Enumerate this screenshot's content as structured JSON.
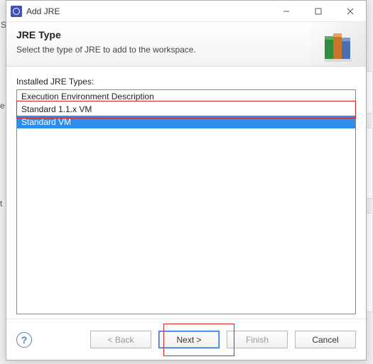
{
  "window": {
    "title": "Add JRE"
  },
  "header": {
    "title": "JRE Type",
    "subtitle": "Select the type of JRE to add to the workspace."
  },
  "list": {
    "label": "Installed JRE Types:",
    "items": [
      "Execution Environment Description",
      "Standard 1.1.x VM",
      "Standard VM"
    ],
    "selected_index": 2
  },
  "buttons": {
    "back": "< Back",
    "next": "Next >",
    "finish": "Finish",
    "cancel": "Cancel"
  },
  "bg_hints": {
    "s": "S",
    "e": "e",
    "t": "t"
  }
}
